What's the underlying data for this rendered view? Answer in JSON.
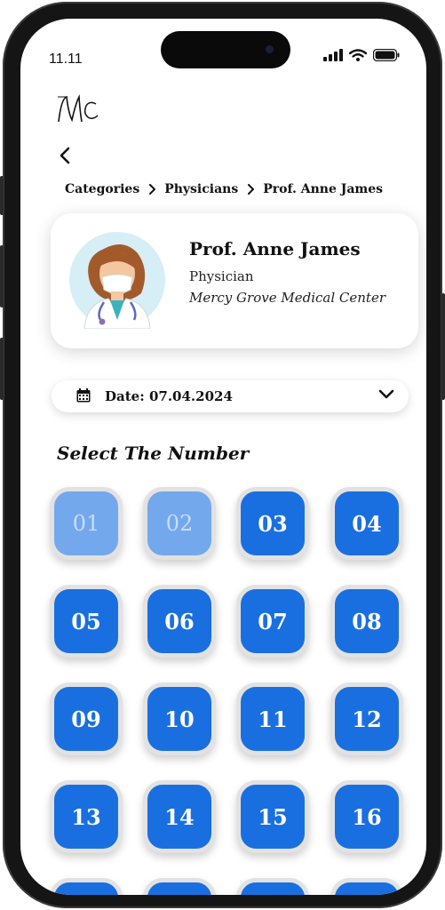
{
  "status_bar": {
    "time": "11.11"
  },
  "logo": {
    "text": "MC"
  },
  "breadcrumb": [
    "Categories",
    "Physicians",
    "Prof. Anne James"
  ],
  "doctor": {
    "name": "Prof. Anne James",
    "role": "Physician",
    "center": "Mercy Grove Medical Center"
  },
  "date_selector": {
    "label": "Date: 07.04.2024"
  },
  "section_title": "Select The Number",
  "numbers": [
    {
      "label": "01",
      "available": false
    },
    {
      "label": "02",
      "available": false
    },
    {
      "label": "03",
      "available": true
    },
    {
      "label": "04",
      "available": true
    },
    {
      "label": "05",
      "available": true
    },
    {
      "label": "06",
      "available": true
    },
    {
      "label": "07",
      "available": true
    },
    {
      "label": "08",
      "available": true
    },
    {
      "label": "09",
      "available": true
    },
    {
      "label": "10",
      "available": true
    },
    {
      "label": "11",
      "available": true
    },
    {
      "label": "12",
      "available": true
    },
    {
      "label": "13",
      "available": true
    },
    {
      "label": "14",
      "available": true
    },
    {
      "label": "15",
      "available": true
    },
    {
      "label": "16",
      "available": true
    },
    {
      "label": "",
      "available": true
    },
    {
      "label": "",
      "available": true
    },
    {
      "label": "",
      "available": true
    },
    {
      "label": "",
      "available": true
    }
  ],
  "colors": {
    "accent": "#1a6fe0",
    "accent_disabled": "#74a8ec"
  }
}
